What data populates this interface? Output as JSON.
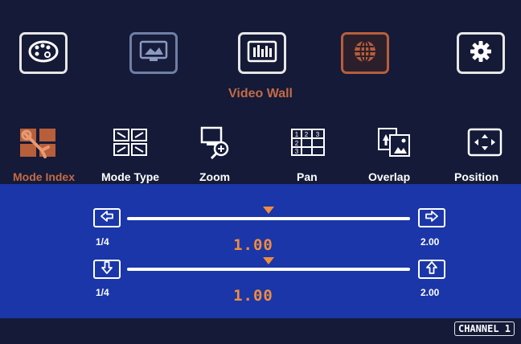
{
  "top_menu": {
    "items": [
      {
        "icon": "palette-icon"
      },
      {
        "icon": "monitor-image-icon"
      },
      {
        "icon": "image-adjust-icon"
      },
      {
        "icon": "globe-icon",
        "selected": true
      },
      {
        "icon": "gear-icon"
      }
    ],
    "section_title": "Video Wall"
  },
  "sub_menu": {
    "items": [
      {
        "label": "Mode Index",
        "icon": "mode-index-icon",
        "selected": true
      },
      {
        "label": "Mode Type",
        "icon": "mode-type-icon"
      },
      {
        "label": "Zoom",
        "icon": "zoom-icon"
      },
      {
        "label": "Pan",
        "icon": "pan-grid-icon"
      },
      {
        "label": "Overlap",
        "icon": "overlap-icon"
      },
      {
        "label": "Position",
        "icon": "position-icon"
      }
    ]
  },
  "sliders": [
    {
      "min_label": "1/4",
      "max_label": "2.00",
      "value_label": "1.00",
      "level": 0.5,
      "decrease_icon": "arrow-left-icon",
      "increase_icon": "arrow-right-icon"
    },
    {
      "min_label": "1/4",
      "max_label": "2.00",
      "value_label": "1.00",
      "level": 0.5,
      "decrease_icon": "arrow-down-icon",
      "increase_icon": "arrow-up-icon"
    }
  ],
  "status": {
    "channel": "CHANNEL 1"
  },
  "colors": {
    "accent": "#c36a45",
    "panel": "#1a36a8",
    "background": "#141a38",
    "slider_thumb": "#f08c3c"
  }
}
